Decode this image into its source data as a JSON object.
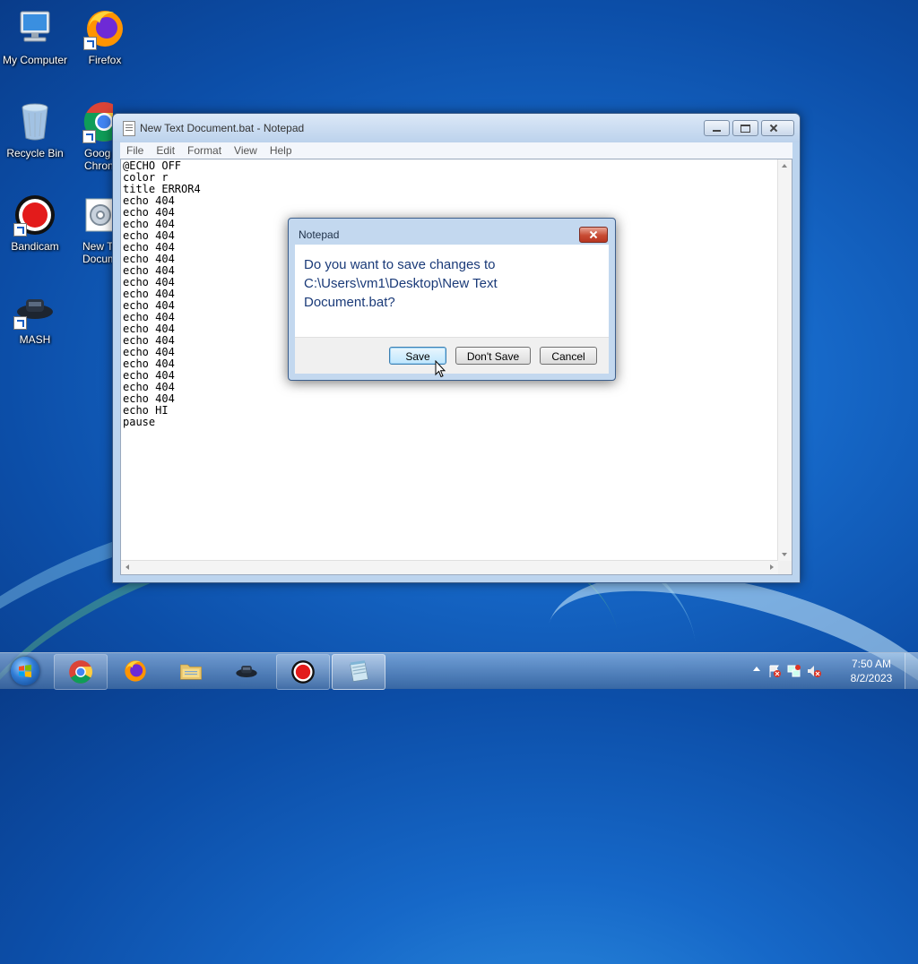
{
  "desktop": {
    "icons": [
      {
        "label": "My Computer"
      },
      {
        "label": "Firefox"
      },
      {
        "label": "Recycle Bin"
      },
      {
        "label": "Goog\nChron"
      },
      {
        "label": "Bandicam"
      },
      {
        "label": "New T\nDocume"
      },
      {
        "label": "MASH"
      }
    ]
  },
  "notepad": {
    "title": "New Text Document.bat - Notepad",
    "menu": [
      "File",
      "Edit",
      "Format",
      "View",
      "Help"
    ],
    "content": "@ECHO OFF\ncolor r\ntitle ERROR4\necho 404\necho 404\necho 404\necho 404\necho 404\necho 404\necho 404\necho 404\necho 404\necho 404\necho 404\necho 404\necho 404\necho 404\necho 404\necho 404\necho 404\necho 404\necho HI\npause"
  },
  "dialog": {
    "title": "Notepad",
    "message": "Do you want to save changes to C:\\Users\\vm1\\Desktop\\New Text Document.bat?",
    "buttons": {
      "save": "Save",
      "dont_save": "Don't Save",
      "cancel": "Cancel"
    }
  },
  "taskbar": {
    "items": [
      "chrome-icon",
      "firefox-icon",
      "explorer-icon",
      "mash-icon",
      "bandicam-icon",
      "notepad-icon"
    ],
    "clock_time": "7:50 AM",
    "clock_date": "8/2/2023"
  },
  "colors": {
    "desktop_blue": "#1668c8",
    "dialog_text": "#1a3a78",
    "close_red": "#c84b33"
  }
}
